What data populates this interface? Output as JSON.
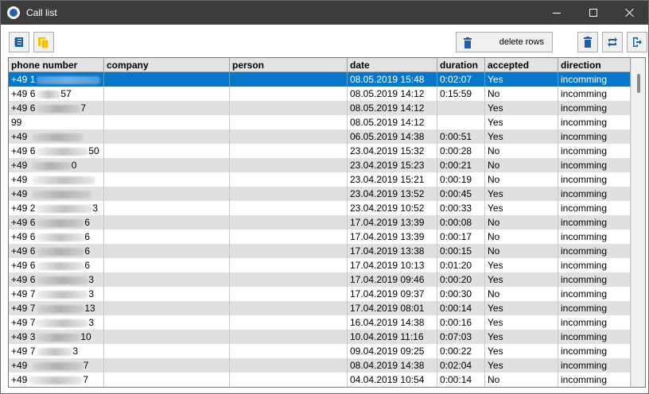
{
  "window": {
    "title": "Call list"
  },
  "toolbar": {
    "delete_rows_label": "delete rows"
  },
  "columns": [
    "phone number",
    "company",
    "person",
    "date",
    "duration",
    "accepted",
    "direction"
  ],
  "rows": [
    {
      "phone": "+49 1",
      "blur": 80,
      "company": "",
      "person": "",
      "date": "08.05.2019 15:48",
      "duration": "0:02:07",
      "accepted": "Yes",
      "direction": "incomming"
    },
    {
      "phone": "+49 6",
      "blur": 30,
      "tail": "57",
      "company": "",
      "person": "",
      "date": "08.05.2019 14:12",
      "duration": "0:15:59",
      "accepted": "No",
      "direction": "incomming"
    },
    {
      "phone": "+49 6",
      "blur": 55,
      "tail": "7",
      "company": "",
      "person": "",
      "date": "08.05.2019 14:12",
      "duration": "",
      "accepted": "Yes",
      "direction": "incomming"
    },
    {
      "phone": "99",
      "blur": 0,
      "company": "",
      "person": "",
      "date": "08.05.2019 14:12",
      "duration": "",
      "accepted": "Yes",
      "direction": "incomming"
    },
    {
      "phone": "+49 ",
      "blur": 65,
      "company": "",
      "person": "",
      "date": "06.05.2019 14:38",
      "duration": "0:00:51",
      "accepted": "Yes",
      "direction": "incomming"
    },
    {
      "phone": "+49 6",
      "blur": 65,
      "tail": "50",
      "company": "",
      "person": "",
      "date": "23.04.2019 15:32",
      "duration": "0:00:28",
      "accepted": "No",
      "direction": "incomming"
    },
    {
      "phone": "+49 ",
      "blur": 50,
      "tail": "0",
      "company": "",
      "person": "",
      "date": "23.04.2019 15:23",
      "duration": "0:00:21",
      "accepted": "No",
      "direction": "incomming"
    },
    {
      "phone": "+49 ",
      "blur": 80,
      "company": "",
      "person": "",
      "date": "23.04.2019 15:21",
      "duration": "0:00:19",
      "accepted": "No",
      "direction": "incomming"
    },
    {
      "phone": "+49 ",
      "blur": 75,
      "company": "",
      "person": "",
      "date": "23.04.2019 13:52",
      "duration": "0:00:45",
      "accepted": "Yes",
      "direction": "incomming"
    },
    {
      "phone": "+49 2",
      "blur": 70,
      "tail": "3",
      "company": "",
      "person": "",
      "date": "23.04.2019 10:52",
      "duration": "0:00:33",
      "accepted": "Yes",
      "direction": "incomming"
    },
    {
      "phone": "+49 6",
      "blur": 60,
      "tail": "6",
      "company": "",
      "person": "",
      "date": "17.04.2019 13:39",
      "duration": "0:00:08",
      "accepted": "No",
      "direction": "incomming"
    },
    {
      "phone": "+49 6",
      "blur": 60,
      "tail": "6",
      "company": "",
      "person": "",
      "date": "17.04.2019 13:39",
      "duration": "0:00:17",
      "accepted": "No",
      "direction": "incomming"
    },
    {
      "phone": "+49 6",
      "blur": 60,
      "tail": "6",
      "company": "",
      "person": "",
      "date": "17.04.2019 13:38",
      "duration": "0:00:15",
      "accepted": "No",
      "direction": "incomming"
    },
    {
      "phone": "+49 6",
      "blur": 60,
      "tail": "6",
      "company": "",
      "person": "",
      "date": "17.04.2019 10:13",
      "duration": "0:01:20",
      "accepted": "Yes",
      "direction": "incomming"
    },
    {
      "phone": "+49 6",
      "blur": 65,
      "tail": "3",
      "company": "",
      "person": "",
      "date": "17.04.2019 09:46",
      "duration": "0:00:20",
      "accepted": "Yes",
      "direction": "incomming"
    },
    {
      "phone": "+49 7",
      "blur": 65,
      "tail": "3",
      "company": "",
      "person": "",
      "date": "17.04.2019 09:37",
      "duration": "0:00:30",
      "accepted": "No",
      "direction": "incomming"
    },
    {
      "phone": "+49 7",
      "blur": 60,
      "tail": "13",
      "company": "",
      "person": "",
      "date": "17.04.2019 08:01",
      "duration": "0:00:14",
      "accepted": "Yes",
      "direction": "incomming"
    },
    {
      "phone": "+49 7",
      "blur": 65,
      "tail": "3",
      "company": "",
      "person": "",
      "date": "16.04.2019 14:38",
      "duration": "0:00:16",
      "accepted": "Yes",
      "direction": "incomming"
    },
    {
      "phone": "+49 3",
      "blur": 55,
      "tail": "10",
      "company": "",
      "person": "",
      "date": "10.04.2019 11:16",
      "duration": "0:07:03",
      "accepted": "Yes",
      "direction": "incomming"
    },
    {
      "phone": "+49 7",
      "blur": 45,
      "tail": "3",
      "company": "",
      "person": "",
      "date": "09.04.2019 09:25",
      "duration": "0:00:22",
      "accepted": "Yes",
      "direction": "incomming"
    },
    {
      "phone": "+49 ",
      "blur": 65,
      "tail": "7",
      "company": "",
      "person": "",
      "date": "08.04.2019 14:38",
      "duration": "0:02:04",
      "accepted": "Yes",
      "direction": "incomming"
    },
    {
      "phone": "+49",
      "blur": 68,
      "tail": "7",
      "company": "",
      "person": "",
      "date": "04.04.2019 10:54",
      "duration": "0:00:14",
      "accepted": "No",
      "direction": "incomming"
    }
  ],
  "selected_row": 0,
  "colors": {
    "titlebar": "#3c3c3c",
    "selection": "#0a76c8",
    "alt_row": "#e0e0e0",
    "icon_blue": "#1f5fa8",
    "icon_yellow": "#f2c500"
  }
}
